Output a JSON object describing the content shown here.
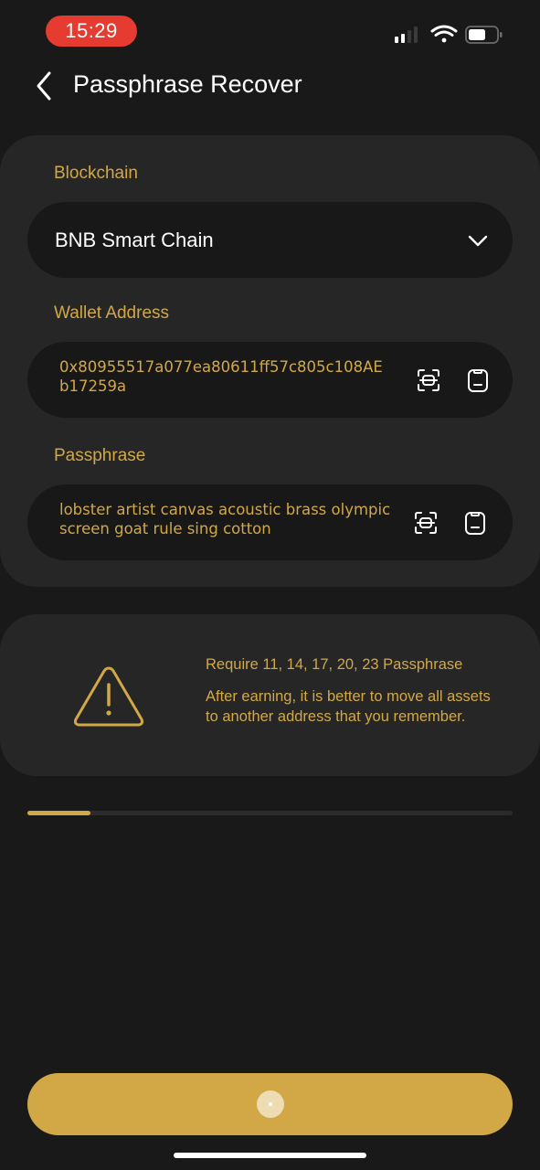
{
  "status_bar": {
    "time": "15:29",
    "icons": [
      "signal-icon",
      "wifi-icon",
      "battery-icon"
    ]
  },
  "header": {
    "title": "Passphrase Recover",
    "back_icon": "chevron-left-icon"
  },
  "form": {
    "blockchain": {
      "label": "Blockchain",
      "value": "BNB Smart Chain",
      "icon": "chevron-down-icon"
    },
    "wallet_address": {
      "label": "Wallet Address",
      "value": "0x80955517a077ea80611ff57c805c108AEb17259a",
      "icons": [
        "scan-icon",
        "paste-icon"
      ]
    },
    "passphrase": {
      "label": "Passphrase",
      "value": "lobster artist canvas acoustic brass olympic screen goat rule sing cotton",
      "icons": [
        "scan-icon",
        "paste-icon"
      ]
    }
  },
  "info": {
    "icon": "warning-icon",
    "title": "Require 11, 14, 17, 20, 23 Passphrase",
    "body": "After earning, it is better to move all assets to another address that you remember."
  },
  "progress": {
    "value": 0.13
  },
  "submit": {
    "state": "loading",
    "icon": "spinner-icon"
  },
  "colors": {
    "background": "#191919",
    "card": "#262626",
    "field": "#181818",
    "accent": "#d2a847",
    "status_time": "#e53b30"
  }
}
